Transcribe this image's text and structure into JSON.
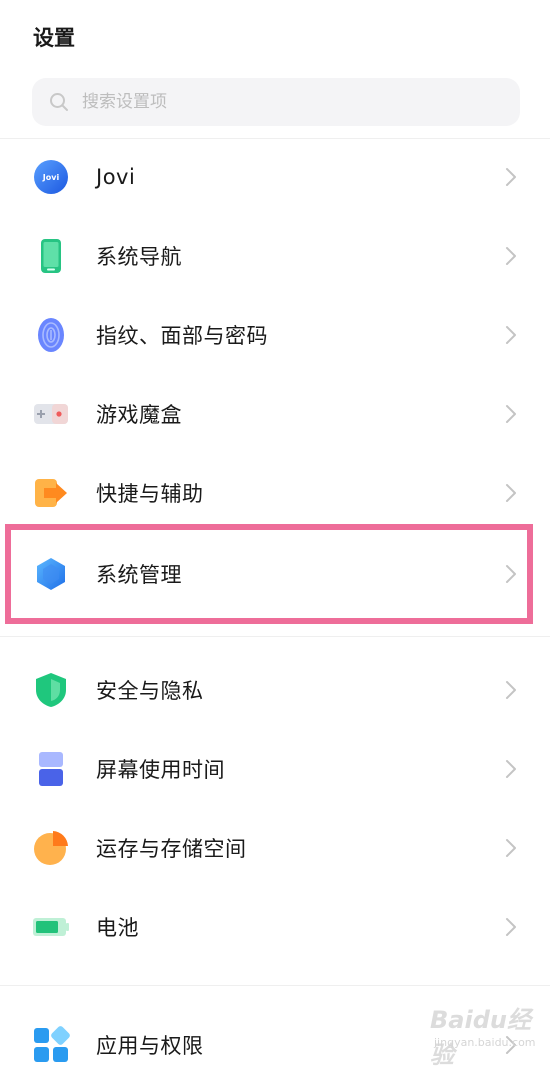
{
  "header": {
    "title": "设置"
  },
  "search": {
    "placeholder": "搜索设置项",
    "value": ""
  },
  "items": [
    {
      "label": "Jovi",
      "icon": "jovi-icon"
    },
    {
      "label": "系统导航",
      "icon": "phone-navigation-icon"
    },
    {
      "label": "指纹、面部与密码",
      "icon": "fingerprint-icon"
    },
    {
      "label": "游戏魔盒",
      "icon": "game-box-icon"
    },
    {
      "label": "快捷与辅助",
      "icon": "shortcut-arrow-icon"
    },
    {
      "label": "系统管理",
      "icon": "system-hexagon-icon"
    },
    {
      "label": "安全与隐私",
      "icon": "shield-icon"
    },
    {
      "label": "屏幕使用时间",
      "icon": "hourglass-icon"
    },
    {
      "label": "运存与存储空间",
      "icon": "pie-chart-icon"
    },
    {
      "label": "电池",
      "icon": "battery-icon"
    },
    {
      "label": "应用与权限",
      "icon": "apps-grid-icon"
    }
  ],
  "watermark": {
    "text": "Baidu经验",
    "sub": "jingyan.baidu.com"
  },
  "colors": {
    "highlight": "#ee6d99",
    "chevron": "#c4c4c4"
  }
}
